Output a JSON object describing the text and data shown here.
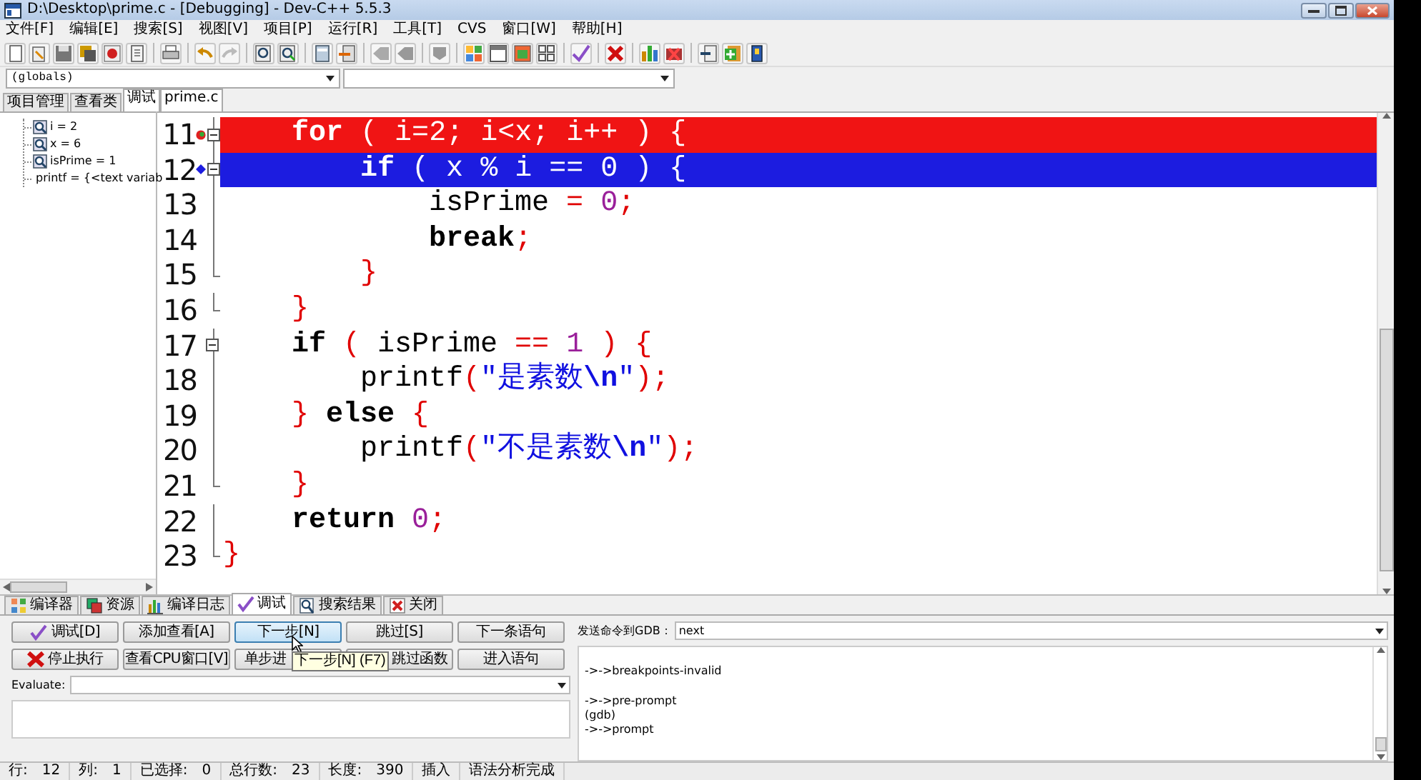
{
  "window": {
    "title": "D:\\Desktop\\prime.c - [Debugging] - Dev-C++ 5.5.3"
  },
  "menu": [
    "文件[F]",
    "编辑[E]",
    "搜索[S]",
    "视图[V]",
    "项目[P]",
    "运行[R]",
    "工具[T]",
    "CVS",
    "窗口[W]",
    "帮助[H]"
  ],
  "scope_selector": {
    "value": "(globals)"
  },
  "left_panel": {
    "tabs": [
      {
        "label": "项目管理",
        "selected": false
      },
      {
        "label": "查看类",
        "selected": false
      },
      {
        "label": "调试",
        "selected": true
      }
    ],
    "watches": [
      "i = 2",
      "x = 6",
      "isPrime = 1",
      "printf = {<text variab"
    ]
  },
  "editor": {
    "tabs": [
      {
        "label": "prime.c",
        "selected": true
      }
    ],
    "lines": [
      {
        "number": "11",
        "kind": "breakpoint",
        "fold_open": true,
        "fold_end": false,
        "tokens": [
          {
            "kind": "kw",
            "text": "    for"
          },
          {
            "kind": "sym",
            "text": " ( "
          },
          {
            "kind": "id",
            "text": "i"
          },
          {
            "kind": "sym",
            "text": "="
          },
          {
            "kind": "num",
            "text": "2"
          },
          {
            "kind": "sym",
            "text": "; "
          },
          {
            "kind": "id",
            "text": "i"
          },
          {
            "kind": "sym",
            "text": "<"
          },
          {
            "kind": "id",
            "text": "x"
          },
          {
            "kind": "sym",
            "text": "; "
          },
          {
            "kind": "id",
            "text": "i"
          },
          {
            "kind": "sym",
            "text": "++ ) {"
          }
        ]
      },
      {
        "number": "12",
        "kind": "current",
        "fold_open": true,
        "fold_end": false,
        "tokens": [
          {
            "kind": "kw",
            "text": "        if"
          },
          {
            "kind": "sym",
            "text": " ( "
          },
          {
            "kind": "id",
            "text": "x "
          },
          {
            "kind": "sym",
            "text": "% "
          },
          {
            "kind": "id",
            "text": "i "
          },
          {
            "kind": "sym",
            "text": "== "
          },
          {
            "kind": "num",
            "text": "0"
          },
          {
            "kind": "sym",
            "text": " ) {"
          }
        ]
      },
      {
        "number": "13",
        "kind": "normal",
        "fold_open": false,
        "fold_end": false,
        "tokens": [
          {
            "kind": "id",
            "text": "            isPrime "
          },
          {
            "kind": "sym",
            "text": "= "
          },
          {
            "kind": "num",
            "text": "0"
          },
          {
            "kind": "sym",
            "text": ";"
          }
        ]
      },
      {
        "number": "14",
        "kind": "normal",
        "fold_open": false,
        "fold_end": false,
        "tokens": [
          {
            "kind": "kw",
            "text": "            break"
          },
          {
            "kind": "sym",
            "text": ";"
          }
        ]
      },
      {
        "number": "15",
        "kind": "normal",
        "fold_open": false,
        "fold_end": true,
        "tokens": [
          {
            "kind": "sym",
            "text": "        }"
          }
        ]
      },
      {
        "number": "16",
        "kind": "normal",
        "fold_open": false,
        "fold_end": true,
        "tokens": [
          {
            "kind": "sym",
            "text": "    }"
          }
        ]
      },
      {
        "number": "17",
        "kind": "normal",
        "fold_open": true,
        "fold_end": false,
        "tokens": [
          {
            "kind": "kw",
            "text": "    if"
          },
          {
            "kind": "sym",
            "text": " ( "
          },
          {
            "kind": "id",
            "text": "isPrime "
          },
          {
            "kind": "sym",
            "text": "== "
          },
          {
            "kind": "num",
            "text": "1"
          },
          {
            "kind": "sym",
            "text": " ) {"
          }
        ]
      },
      {
        "number": "18",
        "kind": "normal",
        "fold_open": false,
        "fold_end": false,
        "tokens": [
          {
            "kind": "id",
            "text": "        printf"
          },
          {
            "kind": "sym",
            "text": "("
          },
          {
            "kind": "str",
            "text": "\"是素数"
          },
          {
            "kind": "esc",
            "text": "\\n"
          },
          {
            "kind": "str",
            "text": "\""
          },
          {
            "kind": "sym",
            "text": ");"
          }
        ]
      },
      {
        "number": "19",
        "kind": "normal",
        "fold_open": false,
        "fold_end": false,
        "tokens": [
          {
            "kind": "sym",
            "text": "    } "
          },
          {
            "kind": "kw",
            "text": "else"
          },
          {
            "kind": "sym",
            "text": " {"
          }
        ]
      },
      {
        "number": "20",
        "kind": "normal",
        "fold_open": false,
        "fold_end": false,
        "tokens": [
          {
            "kind": "id",
            "text": "        printf"
          },
          {
            "kind": "sym",
            "text": "("
          },
          {
            "kind": "str",
            "text": "\"不是素数"
          },
          {
            "kind": "esc",
            "text": "\\n"
          },
          {
            "kind": "str",
            "text": "\""
          },
          {
            "kind": "sym",
            "text": ");"
          }
        ]
      },
      {
        "number": "21",
        "kind": "normal",
        "fold_open": false,
        "fold_end": true,
        "tokens": [
          {
            "kind": "sym",
            "text": "    }"
          }
        ]
      },
      {
        "number": "22",
        "kind": "normal",
        "fold_open": false,
        "fold_end": false,
        "tokens": [
          {
            "kind": "kw",
            "text": "    return "
          },
          {
            "kind": "num",
            "text": "0"
          },
          {
            "kind": "sym",
            "text": ";"
          }
        ]
      },
      {
        "number": "23",
        "kind": "normal",
        "fold_open": false,
        "fold_end": true,
        "tokens": [
          {
            "kind": "sym",
            "text": "}"
          }
        ]
      }
    ]
  },
  "bottom_tabs": [
    {
      "label": "编译器",
      "selected": false
    },
    {
      "label": "资源",
      "selected": false
    },
    {
      "label": "编译日志",
      "selected": false
    },
    {
      "label": "调试",
      "selected": true
    },
    {
      "label": "搜索结果",
      "selected": false
    },
    {
      "label": "关闭",
      "selected": false
    }
  ],
  "debug_buttons": [
    {
      "label": "调试[D]",
      "highlighted": false
    },
    {
      "label": "添加查看[A]",
      "highlighted": false
    },
    {
      "label": "下一步[N]",
      "highlighted": true
    },
    {
      "label": "跳过[S]",
      "highlighted": false
    },
    {
      "label": "下一条语句",
      "highlighted": false
    },
    {
      "label": "停止执行",
      "highlighted": false
    },
    {
      "label": "查看CPU窗口[V]",
      "highlighted": false
    },
    {
      "label": "单步进",
      "highlighted": false
    },
    {
      "label": "跳过函数",
      "highlighted": false
    },
    {
      "label": "进入语句",
      "highlighted": false
    }
  ],
  "tooltip": {
    "text": "下一步[N] (F7)"
  },
  "evaluate": {
    "label": "Evaluate:"
  },
  "gdb": {
    "label": "发送命令到GDB：",
    "value": "next",
    "output": "\n->->breakpoints-invalid\n\n->->pre-prompt\n(gdb)\n->->prompt"
  },
  "status_bar": [
    {
      "label": "行:",
      "value": "12"
    },
    {
      "label": "列:",
      "value": "1"
    },
    {
      "label": "已选择:",
      "value": "0"
    },
    {
      "label": "总行数:",
      "value": "23"
    },
    {
      "label": "长度:",
      "value": "390"
    },
    {
      "label": "插入"
    },
    {
      "label": "语法分析完成"
    }
  ]
}
